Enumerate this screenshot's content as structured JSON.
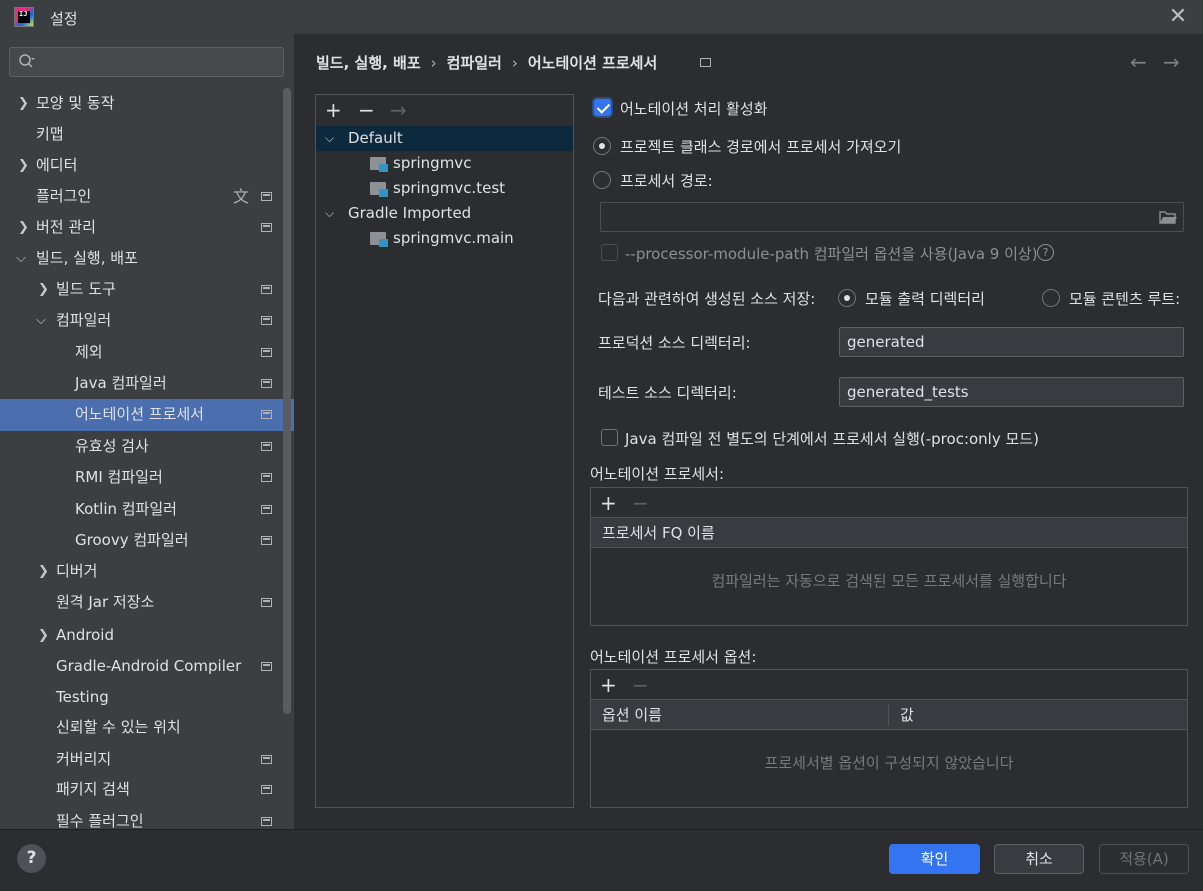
{
  "window": {
    "title": "설정",
    "close_icon": "close-icon"
  },
  "search": {
    "placeholder": "",
    "value": ""
  },
  "sidebar": {
    "items": [
      {
        "label": "모양 및 동작",
        "expandable": true,
        "expanded": false
      },
      {
        "label": "키맵"
      },
      {
        "label": "에디터",
        "expandable": true,
        "expanded": false
      },
      {
        "label": "플러그인"
      },
      {
        "label": "버전 관리",
        "expandable": true,
        "expanded": false
      },
      {
        "label": "빌드, 실행, 배포",
        "expandable": true,
        "expanded": true
      },
      {
        "label": "빌드 도구",
        "expandable": true,
        "expanded": false
      },
      {
        "label": "컴파일러",
        "expandable": true,
        "expanded": true
      },
      {
        "label": "제외"
      },
      {
        "label": "Java 컴파일러"
      },
      {
        "label": "어노테이션 프로세서",
        "selected": true
      },
      {
        "label": "유효성 검사"
      },
      {
        "label": "RMI 컴파일러"
      },
      {
        "label": "Kotlin 컴파일러"
      },
      {
        "label": "Groovy 컴파일러"
      },
      {
        "label": "디버거",
        "expandable": true,
        "expanded": false
      },
      {
        "label": "원격 Jar 저장소"
      },
      {
        "label": "Android",
        "expandable": true,
        "expanded": false
      },
      {
        "label": "Gradle-Android Compiler"
      },
      {
        "label": "Testing"
      },
      {
        "label": "신뢰할 수 있는 위치"
      },
      {
        "label": "커버리지"
      },
      {
        "label": "패키지 검색"
      },
      {
        "label": "필수 플러그인"
      }
    ]
  },
  "breadcrumb": {
    "items": [
      "빌드, 실행, 배포",
      "컴파일러",
      "어노테이션 프로세서"
    ],
    "separator": "›"
  },
  "navigation": {
    "back": "←",
    "forward": "→"
  },
  "profiles": {
    "toolbar": {
      "add": "+",
      "remove": "−",
      "move": "→"
    },
    "tree": [
      {
        "label": "Default",
        "selected": true
      },
      {
        "label": "springmvc"
      },
      {
        "label": "springmvc.test"
      },
      {
        "label": "Gradle Imported"
      },
      {
        "label": "springmvc.main"
      }
    ]
  },
  "settings": {
    "enable_annotation_processing": {
      "label": "어노테이션 처리 활성화",
      "checked": true
    },
    "obtain_from_classpath": {
      "label": "프로젝트 클래스 경로에서 프로세서 가져오기",
      "selected": true
    },
    "processor_path": {
      "label": "프로세서 경로:",
      "selected": false,
      "value": ""
    },
    "module_path_option": {
      "label": "--processor-module-path 컴파일러 옵션을 사용(Java 9 이상)",
      "checked": false,
      "help": "?"
    },
    "store_generated_sources": {
      "label": "다음과 관련하여 생성된 소스 저장:",
      "option_module_output": "모듈 출력 디렉터리",
      "option_module_content_root": "모듈 콘텐츠 루트:",
      "selected": "module_output"
    },
    "production_sources_dir": {
      "label": "프로덕션 소스 디렉터리:",
      "value": "generated"
    },
    "test_sources_dir": {
      "label": "테스트 소스 디렉터리:",
      "value": "generated_tests"
    },
    "run_separate_step": {
      "label": "Java 컴파일 전 별도의 단계에서 프로세서 실행(-proc:only 모드)",
      "checked": false
    },
    "processors": {
      "title": "어노테이션 프로세서:",
      "add": "+",
      "remove": "−",
      "column": "프로세서 FQ 이름",
      "empty_text": "컴파일러는 자동으로 검색된 모든 프로세서를 실행합니다"
    },
    "processor_options": {
      "title": "어노테이션 프로세서 옵션:",
      "add": "+",
      "remove": "−",
      "columns": [
        "옵션 이름",
        "값"
      ],
      "empty_text": "프로세서별 옵션이 구성되지 않았습니다"
    }
  },
  "footer": {
    "help": "?",
    "ok": "확인",
    "cancel": "취소",
    "apply": "적용(A)"
  },
  "colors": {
    "accent": "#3574f0",
    "selection": "#4b6eaf",
    "background": "#2b2d30",
    "sidebar_bg": "#3c3f41"
  }
}
